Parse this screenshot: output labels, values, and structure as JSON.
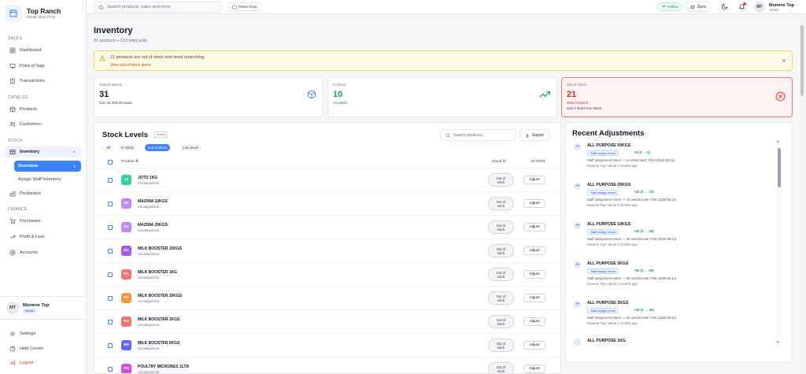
{
  "brand": {
    "title": "Top Ranch",
    "subtitle": "Retail Shop POS"
  },
  "sidebar": {
    "sections": {
      "sales": "SALES",
      "catalog": "CATALOG",
      "stock": "STOCK",
      "finance": "FINANCE"
    },
    "items": {
      "dashboard": "Dashboard",
      "pos": "Point of Sale",
      "transactions": "Transactions",
      "products": "Products",
      "customers": "Customers",
      "inventory": "Inventory",
      "overview": "Overview",
      "assign_staff": "Assign Staff Inventory",
      "production": "Production",
      "purchases": "Purchases",
      "profit_loss": "Profit & Loss",
      "accounts": "Accounts",
      "settings": "Settings",
      "help": "Help Center",
      "logout": "Logout"
    },
    "user": {
      "initials": "MT",
      "name": "Munene Top",
      "role": "Admin"
    }
  },
  "topbar": {
    "search_placeholder": "Search products, sales and more",
    "shop": "Retail Shop",
    "online": "Online",
    "sync": "Sync",
    "user": {
      "initials": "MT",
      "name": "Munene Top",
      "role": "Admin"
    }
  },
  "page": {
    "title": "Inventory",
    "subtitle": "31 products • 213 total units"
  },
  "alert": {
    "text": "21 products are out of stock and need restocking.",
    "link": "View out-of-stock items"
  },
  "cards": {
    "total": {
      "label": "Total Products",
      "value": "31",
      "note": "Ksh 32,400.00 value"
    },
    "in_stock": {
      "label": "In Stock",
      "value": "10",
      "note": "Available"
    },
    "out_stock": {
      "label": "Out of Stock",
      "value": "21",
      "note1": "Need restock",
      "note2": "and 4 items low stock"
    }
  },
  "stock_levels": {
    "title": "Stock Levels",
    "tag": "Sorted",
    "search_placeholder": "Search products...",
    "export": "Export",
    "filters": [
      "All",
      "In Stock",
      "Out of Stock",
      "Low Stock"
    ],
    "headers": {
      "product": "Product",
      "stock": "Stock",
      "action": "ACTION"
    },
    "status_line1": "Out of",
    "status_line2": "stock",
    "adjust": "Adjust",
    "rows": [
      {
        "initials": "J1",
        "color": "#34d399",
        "name": "JOTO 1KG",
        "category": "Uncategorized"
      },
      {
        "initials": "M1",
        "color": "#c084fc",
        "name": "MAZIWA 10KGS",
        "category": "Uncategorized"
      },
      {
        "initials": "M2",
        "color": "#c084fc",
        "name": "MAZIWA 20KGS",
        "category": "Uncategorized"
      },
      {
        "initials": "M1",
        "color": "#a855f7",
        "name": "MILK BOOSTER 15KGS",
        "category": "Uncategorized"
      },
      {
        "initials": "M1",
        "color": "#f87171",
        "name": "MILK BOOSTER 1KG",
        "category": "Uncategorized"
      },
      {
        "initials": "M2",
        "color": "#fb923c",
        "name": "MILK BOOSTER 20KGS",
        "category": "Uncategorized"
      },
      {
        "initials": "M2",
        "color": "#f87171",
        "name": "MILK BOOSTER 2KGS",
        "category": "Uncategorized"
      },
      {
        "initials": "M5",
        "color": "#6366f1",
        "name": "MILK BOOSTER 5KGS",
        "category": "Uncategorized"
      },
      {
        "initials": "PM",
        "color": "#d946ef",
        "name": "POULTRY MICROBES 1LTR",
        "category": "Uncategorized"
      }
    ]
  },
  "recent": {
    "title": "Recent Adjustments",
    "items": [
      {
        "name": "ALL PURPOSE 50KGS",
        "chip": "Staff assign return",
        "delta": "+5  (0 → 5)",
        "note": "Staff assignment return — 5 unsold units: First (2026-06-11)",
        "meta": "Munene Top  •  about 2 months ago"
      },
      {
        "name": "ALL PURPOSE 20KGS",
        "chip": "Staff assign return",
        "delta": "+10  (0 → 10)",
        "note": "Staff assignment return — 10 unsold units: First (2026-06-11)",
        "meta": "Munene Top  •  about 2 months ago"
      },
      {
        "name": "ALL PURPOSE 10KGS",
        "chip": "Staff assign return",
        "delta": "+40  (0 → 40)",
        "note": "Staff assignment return — 40 unsold units: First (2026-06-11)",
        "meta": "Munene Top  •  about 2 months ago"
      },
      {
        "name": "ALL PURPOSE 5KGS",
        "chip": "Staff assign return",
        "delta": "+50  (0 → 50)",
        "note": "Staff assignment return — 50 unsold units: First (2026-06-11)",
        "meta": "Munene Top  •  about 2 months ago"
      },
      {
        "name": "ALL PURPOSE 2KGS",
        "chip": "Staff assign return",
        "delta": "+30  (0 → 30)",
        "note": "Staff assignment return — 30 unsold units: First (2026-06-11)",
        "meta": "Munene Top  •  about 2 months ago"
      }
    ],
    "partial_item": "ALL PURPOSE 1KG"
  },
  "colors": {
    "accent": "#3b82f6",
    "danger": "#ef4444",
    "success": "#16a34a",
    "warning": "#f59e0b"
  }
}
